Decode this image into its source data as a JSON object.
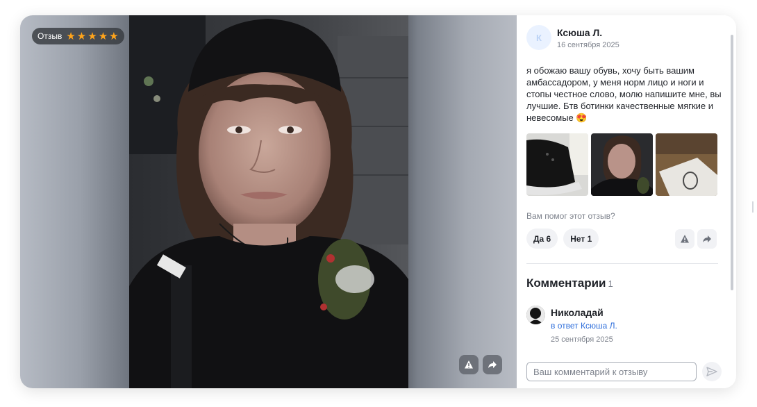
{
  "gallery": {
    "badge_label": "Отзыв",
    "rating": 5,
    "stars": [
      "★",
      "★",
      "★",
      "★",
      "★"
    ],
    "photo_alt": "фото к отзыву",
    "actions": [
      {
        "icon": "warning-icon"
      },
      {
        "icon": "share-icon"
      }
    ]
  },
  "review": {
    "author": {
      "initial": "К",
      "name": "Ксюша Л.",
      "date": "16 сентября 2025"
    },
    "text": "я обожаю вашу обувь, хочу быть вашим амбассадором, у меня норм лицо и ноги и стопы честное слово, молю напишите мне, вы лучшие. Бтв ботинки качественные мягкие и невесомые 😍",
    "thumbnails": [
      {
        "icon": "boot-photo"
      },
      {
        "icon": "selfie-photo"
      },
      {
        "icon": "box-photo"
      }
    ],
    "helpful_question": "Вам помог этот отзыв?",
    "votes": {
      "yes_label": "Да 6",
      "no_label": "Нет 1"
    }
  },
  "comments": {
    "title": "Комментарии",
    "count": "1",
    "items": [
      {
        "name": "Николадай",
        "reply_to": "в ответ Ксюша Л.",
        "date": "25 сентября 2025"
      }
    ],
    "input_placeholder": "Ваш комментарий к отзыву"
  },
  "colors": {
    "star": "#ffa41b",
    "link": "#2f6fdb",
    "muted": "#7d828c",
    "button_bg": "#f1f2f5"
  }
}
